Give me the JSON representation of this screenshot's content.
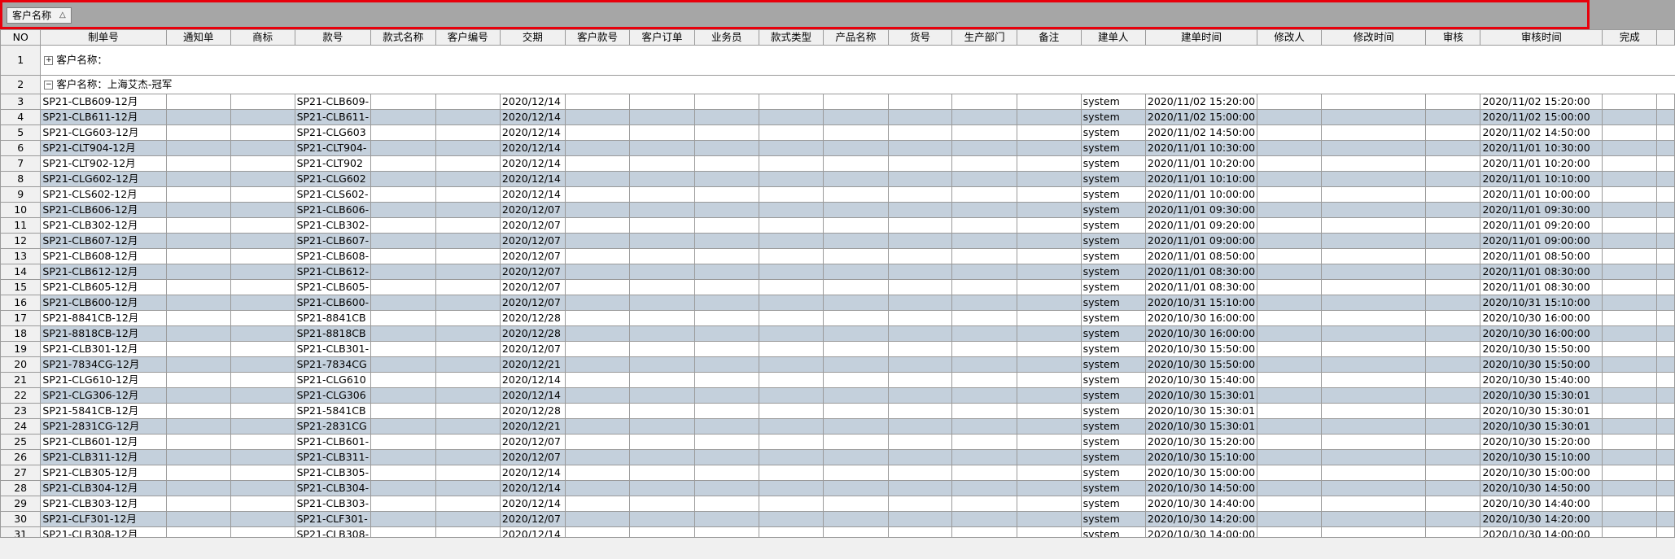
{
  "group_panel": {
    "chip_label": "客户名称",
    "chip_sort_glyph": "△"
  },
  "columns": [
    "NO",
    "制单号",
    "通知单",
    "商标",
    "款号",
    "款式名称",
    "客户编号",
    "交期",
    "客户款号",
    "客户订单",
    "业务员",
    "款式类型",
    "产品名称",
    "货号",
    "生产部门",
    "备注",
    "建单人",
    "建单时间",
    "修改人",
    "修改时间",
    "审核",
    "审核时间",
    "完成",
    ""
  ],
  "groups": [
    {
      "no": "1",
      "label": "客户名称：",
      "expander": "+"
    },
    {
      "no": "2",
      "label": "客户名称：上海艾杰-冠军",
      "expander": "−"
    }
  ],
  "rows": [
    {
      "no": "3",
      "order": "SP21-CLB609-12月",
      "style": "SP21-CLB609-",
      "delivery": "2020/12/14",
      "creator": "system",
      "created": "2020/11/02 15:20:00",
      "reviewed": "2020/11/02 15:20:00"
    },
    {
      "no": "4",
      "order": "SP21-CLB611-12月",
      "style": "SP21-CLB611-",
      "delivery": "2020/12/14",
      "creator": "system",
      "created": "2020/11/02 15:00:00",
      "reviewed": "2020/11/02 15:00:00"
    },
    {
      "no": "5",
      "order": "SP21-CLG603-12月",
      "style": "SP21-CLG603",
      "delivery": "2020/12/14",
      "creator": "system",
      "created": "2020/11/02 14:50:00",
      "reviewed": "2020/11/02 14:50:00"
    },
    {
      "no": "6",
      "order": "SP21-CLT904-12月",
      "style": "SP21-CLT904-",
      "delivery": "2020/12/14",
      "creator": "system",
      "created": "2020/11/01 10:30:00",
      "reviewed": "2020/11/01 10:30:00"
    },
    {
      "no": "7",
      "order": "SP21-CLT902-12月",
      "style": "SP21-CLT902",
      "delivery": "2020/12/14",
      "creator": "system",
      "created": "2020/11/01 10:20:00",
      "reviewed": "2020/11/01 10:20:00"
    },
    {
      "no": "8",
      "order": "SP21-CLG602-12月",
      "style": "SP21-CLG602",
      "delivery": "2020/12/14",
      "creator": "system",
      "created": "2020/11/01 10:10:00",
      "reviewed": "2020/11/01 10:10:00"
    },
    {
      "no": "9",
      "order": "SP21-CLS602-12月",
      "style": "SP21-CLS602-",
      "delivery": "2020/12/14",
      "creator": "system",
      "created": "2020/11/01 10:00:00",
      "reviewed": "2020/11/01 10:00:00"
    },
    {
      "no": "10",
      "order": "SP21-CLB606-12月",
      "style": "SP21-CLB606-",
      "delivery": "2020/12/07",
      "creator": "system",
      "created": "2020/11/01 09:30:00",
      "reviewed": "2020/11/01 09:30:00"
    },
    {
      "no": "11",
      "order": "SP21-CLB302-12月",
      "style": "SP21-CLB302-",
      "delivery": "2020/12/07",
      "creator": "system",
      "created": "2020/11/01 09:20:00",
      "reviewed": "2020/11/01 09:20:00"
    },
    {
      "no": "12",
      "order": "SP21-CLB607-12月",
      "style": "SP21-CLB607-",
      "delivery": "2020/12/07",
      "creator": "system",
      "created": "2020/11/01 09:00:00",
      "reviewed": "2020/11/01 09:00:00"
    },
    {
      "no": "13",
      "order": "SP21-CLB608-12月",
      "style": "SP21-CLB608-",
      "delivery": "2020/12/07",
      "creator": "system",
      "created": "2020/11/01 08:50:00",
      "reviewed": "2020/11/01 08:50:00"
    },
    {
      "no": "14",
      "order": "SP21-CLB612-12月",
      "style": "SP21-CLB612-",
      "delivery": "2020/12/07",
      "creator": "system",
      "created": "2020/11/01 08:30:00",
      "reviewed": "2020/11/01 08:30:00"
    },
    {
      "no": "15",
      "order": "SP21-CLB605-12月",
      "style": "SP21-CLB605-",
      "delivery": "2020/12/07",
      "creator": "system",
      "created": "2020/11/01 08:30:00",
      "reviewed": "2020/11/01 08:30:00"
    },
    {
      "no": "16",
      "order": "SP21-CLB600-12月",
      "style": "SP21-CLB600-",
      "delivery": "2020/12/07",
      "creator": "system",
      "created": "2020/10/31 15:10:00",
      "reviewed": "2020/10/31 15:10:00"
    },
    {
      "no": "17",
      "order": "SP21-8841CB-12月",
      "style": "SP21-8841CB",
      "delivery": "2020/12/28",
      "creator": "system",
      "created": "2020/10/30 16:00:00",
      "reviewed": "2020/10/30 16:00:00"
    },
    {
      "no": "18",
      "order": "SP21-8818CB-12月",
      "style": "SP21-8818CB",
      "delivery": "2020/12/28",
      "creator": "system",
      "created": "2020/10/30 16:00:00",
      "reviewed": "2020/10/30 16:00:00"
    },
    {
      "no": "19",
      "order": "SP21-CLB301-12月",
      "style": "SP21-CLB301-",
      "delivery": "2020/12/07",
      "creator": "system",
      "created": "2020/10/30 15:50:00",
      "reviewed": "2020/10/30 15:50:00"
    },
    {
      "no": "20",
      "order": "SP21-7834CG-12月",
      "style": "SP21-7834CG",
      "delivery": "2020/12/21",
      "creator": "system",
      "created": "2020/10/30 15:50:00",
      "reviewed": "2020/10/30 15:50:00"
    },
    {
      "no": "21",
      "order": "SP21-CLG610-12月",
      "style": "SP21-CLG610",
      "delivery": "2020/12/14",
      "creator": "system",
      "created": "2020/10/30 15:40:00",
      "reviewed": "2020/10/30 15:40:00"
    },
    {
      "no": "22",
      "order": "SP21-CLG306-12月",
      "style": "SP21-CLG306",
      "delivery": "2020/12/14",
      "creator": "system",
      "created": "2020/10/30 15:30:01",
      "reviewed": "2020/10/30 15:30:01"
    },
    {
      "no": "23",
      "order": "SP21-5841CB-12月",
      "style": "SP21-5841CB",
      "delivery": "2020/12/28",
      "creator": "system",
      "created": "2020/10/30 15:30:01",
      "reviewed": "2020/10/30 15:30:01"
    },
    {
      "no": "24",
      "order": "SP21-2831CG-12月",
      "style": "SP21-2831CG",
      "delivery": "2020/12/21",
      "creator": "system",
      "created": "2020/10/30 15:30:01",
      "reviewed": "2020/10/30 15:30:01"
    },
    {
      "no": "25",
      "order": "SP21-CLB601-12月",
      "style": "SP21-CLB601-",
      "delivery": "2020/12/07",
      "creator": "system",
      "created": "2020/10/30 15:20:00",
      "reviewed": "2020/10/30 15:20:00"
    },
    {
      "no": "26",
      "order": "SP21-CLB311-12月",
      "style": "SP21-CLB311-",
      "delivery": "2020/12/07",
      "creator": "system",
      "created": "2020/10/30 15:10:00",
      "reviewed": "2020/10/30 15:10:00"
    },
    {
      "no": "27",
      "order": "SP21-CLB305-12月",
      "style": "SP21-CLB305-",
      "delivery": "2020/12/14",
      "creator": "system",
      "created": "2020/10/30 15:00:00",
      "reviewed": "2020/10/30 15:00:00"
    },
    {
      "no": "28",
      "order": "SP21-CLB304-12月",
      "style": "SP21-CLB304-",
      "delivery": "2020/12/14",
      "creator": "system",
      "created": "2020/10/30 14:50:00",
      "reviewed": "2020/10/30 14:50:00"
    },
    {
      "no": "29",
      "order": "SP21-CLB303-12月",
      "style": "SP21-CLB303-",
      "delivery": "2020/12/14",
      "creator": "system",
      "created": "2020/10/30 14:40:00",
      "reviewed": "2020/10/30 14:40:00"
    },
    {
      "no": "30",
      "order": "SP21-CLF301-12月",
      "style": "SP21-CLF301-",
      "delivery": "2020/12/07",
      "creator": "system",
      "created": "2020/10/30 14:20:00",
      "reviewed": "2020/10/30 14:20:00"
    },
    {
      "no": "31",
      "order": "SP21-CLB308-12月",
      "style": "SP21-CLB308-",
      "delivery": "2020/12/14",
      "creator": "system",
      "created": "2020/10/30 14:00:00",
      "reviewed": "2020/10/30 14:00:00"
    }
  ]
}
